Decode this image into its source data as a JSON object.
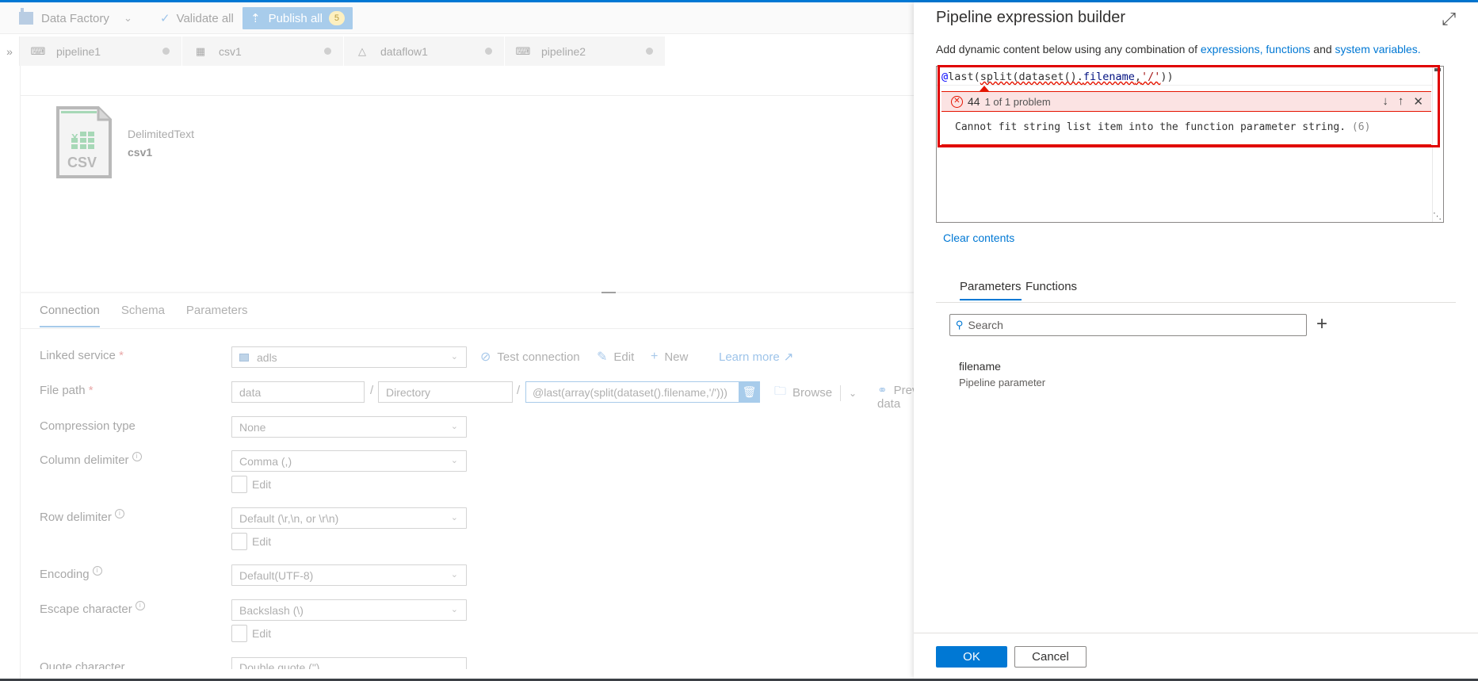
{
  "toolbar": {
    "factory_label": "Data Factory",
    "validate_label": "Validate all",
    "publish_label": "Publish all",
    "publish_count": "5"
  },
  "doc_tabs": [
    {
      "label": "pipeline1",
      "icon": "pipeline-icon"
    },
    {
      "label": "csv1",
      "icon": "table-icon"
    },
    {
      "label": "dataflow1",
      "icon": "dataflow-icon"
    },
    {
      "label": "pipeline2",
      "icon": "pipeline-icon"
    }
  ],
  "dataset": {
    "icon_text": "CSV",
    "type": "DelimitedText",
    "name": "csv1"
  },
  "props_tabs": [
    "Connection",
    "Schema",
    "Parameters"
  ],
  "form": {
    "linked_service": {
      "label": "Linked service",
      "required": "*",
      "value": "adls"
    },
    "actions": {
      "test": "Test connection",
      "edit": "Edit",
      "new": "New",
      "learn": "Learn more"
    },
    "file_path": {
      "label": "File path",
      "required": "*",
      "container": "data",
      "directory_placeholder": "Directory",
      "file_expression": "@last(array(split(dataset().filename,'/')))",
      "browse": "Browse",
      "preview": "Preview data"
    },
    "compression": {
      "label": "Compression type",
      "value": "None"
    },
    "column_delimiter": {
      "label": "Column delimiter",
      "value": "Comma (,)",
      "edit": "Edit"
    },
    "row_delimiter": {
      "label": "Row delimiter",
      "value": "Default (\\r,\\n, or \\r\\n)",
      "edit": "Edit"
    },
    "encoding": {
      "label": "Encoding",
      "value": "Default(UTF-8)"
    },
    "escape_char": {
      "label": "Escape character",
      "value": "Backslash (\\)",
      "edit": "Edit"
    },
    "quote_char": {
      "label": "Quote character",
      "value": "Double quote (\")"
    }
  },
  "panel": {
    "title": "Pipeline expression builder",
    "desc_prefix": "Add dynamic content below using any combination of ",
    "link_expressions": "expressions,",
    "link_functions": "functions",
    "desc_and": " and ",
    "link_sysvars": "system variables.",
    "expression": {
      "at": "@",
      "fn1": "last(",
      "fn2": "split(dataset().",
      "prop": "filename",
      "comma": ",",
      "str": "'/'",
      "close": "))"
    },
    "error": {
      "code": "44",
      "count": "1 of 1 problem",
      "message": "Cannot fit string list item into the function parameter string.",
      "ref": "(6)"
    },
    "clear_label": "Clear contents",
    "tabs": [
      "Parameters",
      "Functions"
    ],
    "search_placeholder": "Search",
    "params": [
      {
        "name": "filename",
        "type": "Pipeline parameter"
      }
    ],
    "ok_label": "OK",
    "cancel_label": "Cancel"
  }
}
